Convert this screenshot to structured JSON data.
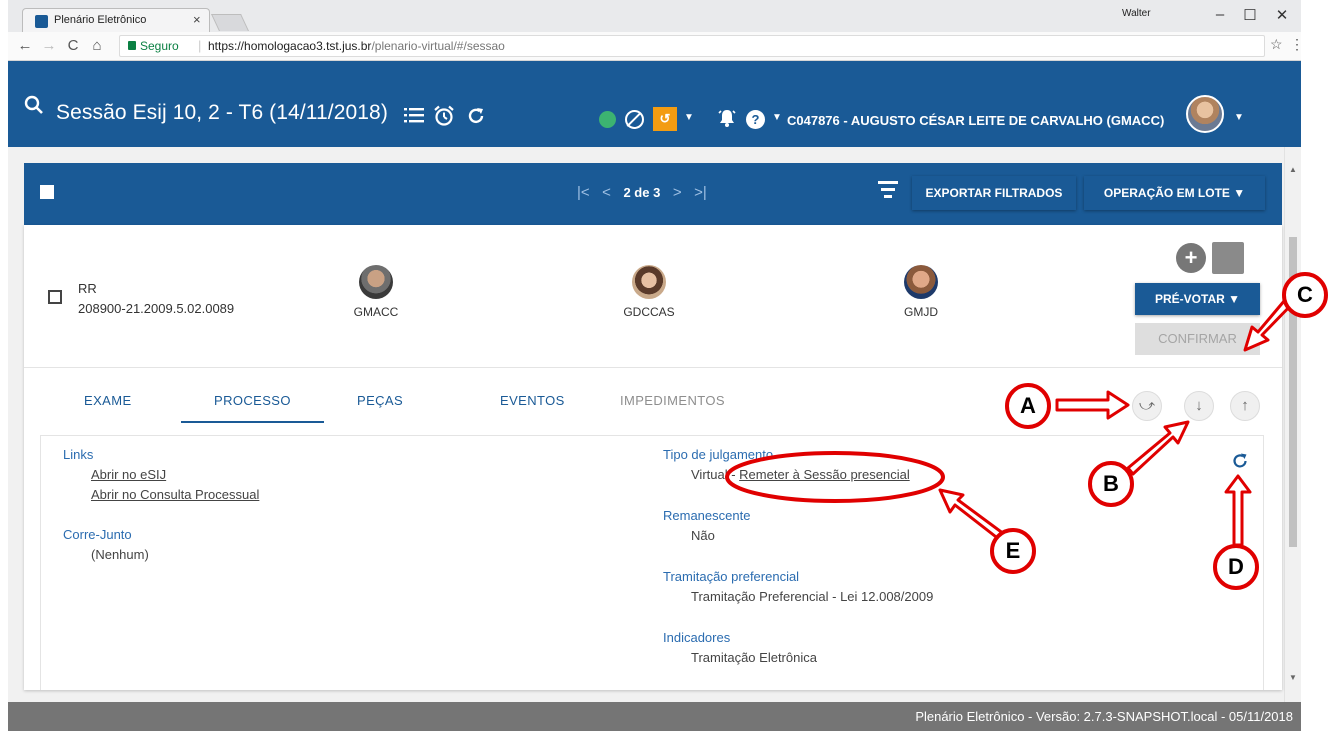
{
  "browser": {
    "tab_title": "Plenário Eletrônico",
    "tab_close": "×",
    "user": "Walter",
    "minimize": "–",
    "maximize": "☐",
    "close": "✕",
    "secure_label": "Seguro",
    "url_host": "https://homologacao3.tst.jus.br",
    "url_path": "/plenario-virtual/#/sessao",
    "back": "←",
    "forward": "→",
    "reload": "C",
    "home": "⌂",
    "star": "☆",
    "menu": "⋮"
  },
  "header": {
    "title": "Sessão Esij 10, 2 - T6 (14/11/2018)",
    "user": "C047876 - AUGUSTO CÉSAR LEITE DE CARVALHO (GMACC)",
    "sync_label": "↺"
  },
  "toolbar": {
    "pager_first": "|<",
    "pager_prev": "<",
    "pager_current": "2 de 3",
    "pager_next": ">",
    "pager_last": ">|",
    "export_label": "EXPORTAR FILTRADOS",
    "lote_label": "OPERAÇÃO EM LOTE ▼"
  },
  "process": {
    "class": "RR",
    "number": "208900-21.2009.5.02.0089",
    "judges": [
      {
        "code": "GMACC"
      },
      {
        "code": "GDCCAS"
      },
      {
        "code": "GMJD"
      }
    ],
    "prevotar_label": "PRÉ-VOTAR ▼",
    "confirmar_label": "CONFIRMAR"
  },
  "tabs": [
    {
      "label": "EXAME"
    },
    {
      "label": "PROCESSO"
    },
    {
      "label": "PEÇAS"
    },
    {
      "label": "EVENTOS"
    },
    {
      "label": "IMPEDIMENTOS"
    }
  ],
  "details": {
    "links_label": "Links",
    "link_esij": "Abrir no eSIJ",
    "link_consulta": "Abrir no Consulta Processual",
    "corre_label": "Corre-Junto",
    "corre_value": "(Nenhum)",
    "tipo_label": "Tipo de julgamento",
    "tipo_value": "Virtual - ",
    "tipo_link": "Remeter à Sessão presencial",
    "remanescente_label": "Remanescente",
    "remanescente_value": "Não",
    "tramitacao_label": "Tramitação preferencial",
    "tramitacao_value": "Tramitação Preferencial - Lei 12.008/2009",
    "indicadores_label": "Indicadores",
    "indicadores_value": "Tramitação Eletrônica"
  },
  "annotations": [
    "A",
    "B",
    "C",
    "D",
    "E"
  ],
  "footer": "Plenário Eletrônico - Versão: 2.7.3-SNAPSHOT.local - 05/11/2018",
  "colors": {
    "primary": "#1a5a96",
    "annotation": "#e00000",
    "accent_orange": "#f39c12",
    "status_green": "#3cb371"
  }
}
